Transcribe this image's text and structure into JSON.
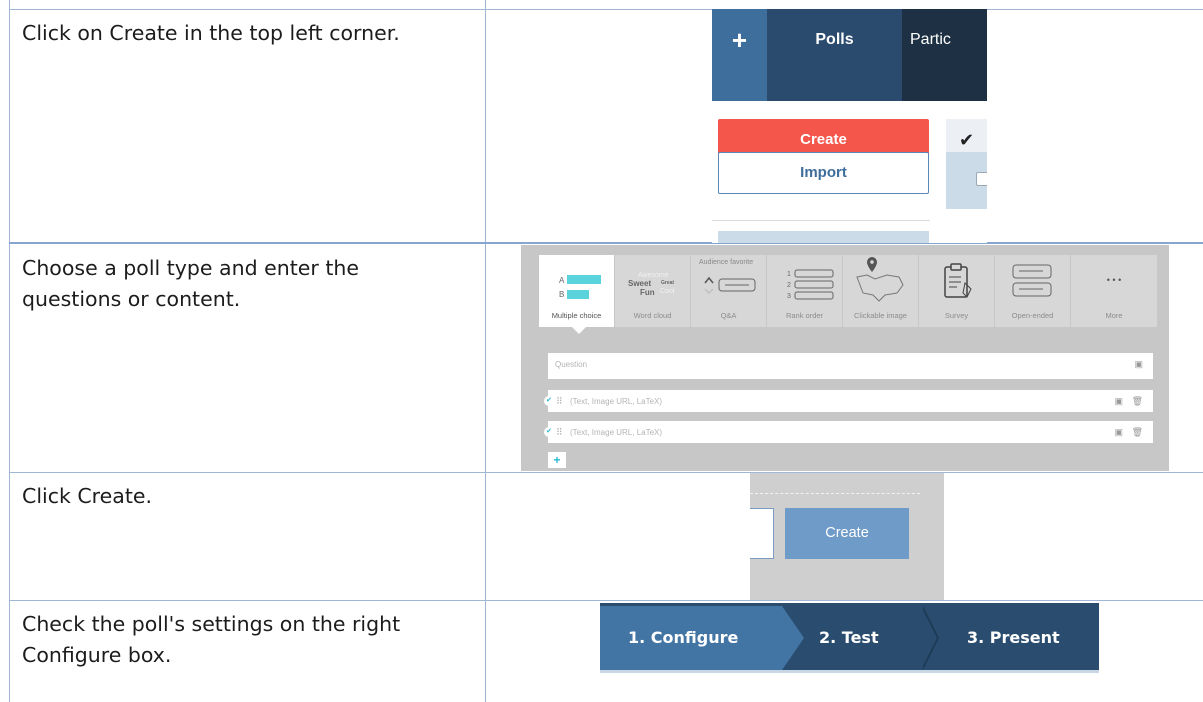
{
  "steps": [
    {
      "text": "Click on Create in the top left corner."
    },
    {
      "text": "Choose a poll type and enter the questions or content."
    },
    {
      "text": "Click Create."
    },
    {
      "text": "Check the poll's settings on the right Configure box."
    }
  ],
  "polls_ui": {
    "plus_label": "+",
    "polls_tab": "Polls",
    "participants_tab_partial": "Partic",
    "create_label": "Create",
    "import_label": "Import",
    "check_icon": "✔",
    "colors": {
      "header": "#1e3044",
      "create": "#f4564c",
      "accent": "#3e6e9c"
    }
  },
  "poll_types": {
    "items": [
      {
        "label": "Multiple choice",
        "icon": "bar-options-icon"
      },
      {
        "label": "Word cloud",
        "icon": "word-cloud-icon"
      },
      {
        "label": "Q&A",
        "icon": "qa-icon"
      },
      {
        "label": "Rank order",
        "icon": "rank-order-icon"
      },
      {
        "label": "Clickable image",
        "icon": "map-pin-icon"
      },
      {
        "label": "Survey",
        "icon": "clipboard-icon"
      },
      {
        "label": "Open-ended",
        "icon": "chat-bubbles-icon"
      },
      {
        "label": "More",
        "icon": "more-dots-icon"
      }
    ],
    "mc_a": "A",
    "mc_b": "B",
    "wc_awesome": "Awesome",
    "wc_sweet": "Sweet",
    "wc_great": "Great",
    "wc_fun": "Fun",
    "wc_cool": "Cool",
    "qa_audience": "Audience favorite",
    "rank_1": "1",
    "rank_2": "2",
    "rank_3": "3",
    "more_dots": "• • •",
    "question_placeholder": "Question",
    "option_placeholder": "(Text, Image URL, LaTeX)",
    "add_label": "+"
  },
  "create_ui": {
    "create_label": "Create"
  },
  "stepbar": {
    "steps": [
      "1. Configure",
      "2. Test",
      "3. Present"
    ],
    "colors": {
      "active": "#4274a4",
      "inactive": "#2a4d6f"
    }
  }
}
